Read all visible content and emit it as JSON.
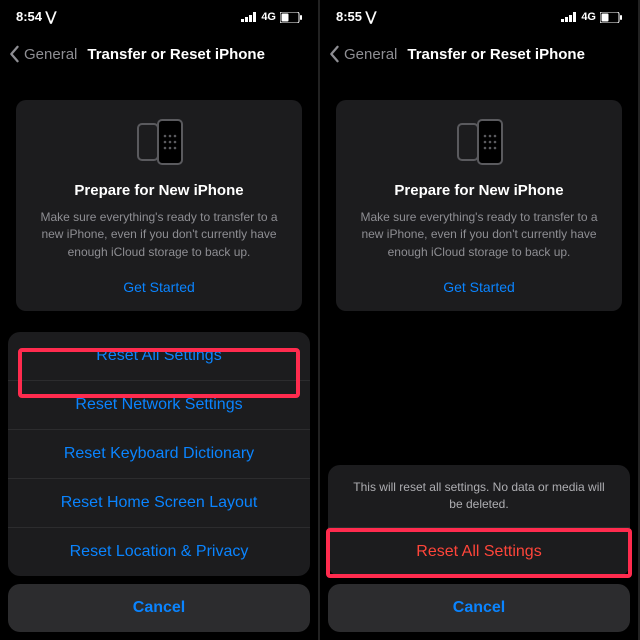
{
  "left": {
    "status": {
      "time": "8:54 ⋁",
      "network": "4G"
    },
    "nav": {
      "back": "General",
      "title": "Transfer or Reset iPhone"
    },
    "card": {
      "title": "Prepare for New iPhone",
      "desc": "Make sure everything's ready to transfer to a new iPhone, even if you don't currently have enough iCloud storage to back up.",
      "link": "Get Started"
    },
    "sheet": {
      "items": [
        "Reset All Settings",
        "Reset Network Settings",
        "Reset Keyboard Dictionary",
        "Reset Home Screen Layout",
        "Reset Location & Privacy"
      ],
      "cancel": "Cancel"
    }
  },
  "right": {
    "status": {
      "time": "8:55 ⋁",
      "network": "4G"
    },
    "nav": {
      "back": "General",
      "title": "Transfer or Reset iPhone"
    },
    "card": {
      "title": "Prepare for New iPhone",
      "desc": "Make sure everything's ready to transfer to a new iPhone, even if you don't currently have enough iCloud storage to back up.",
      "link": "Get Started"
    },
    "sheet": {
      "message": "This will reset all settings. No data or media will be deleted.",
      "confirm": "Reset All Settings",
      "cancel": "Cancel"
    }
  }
}
